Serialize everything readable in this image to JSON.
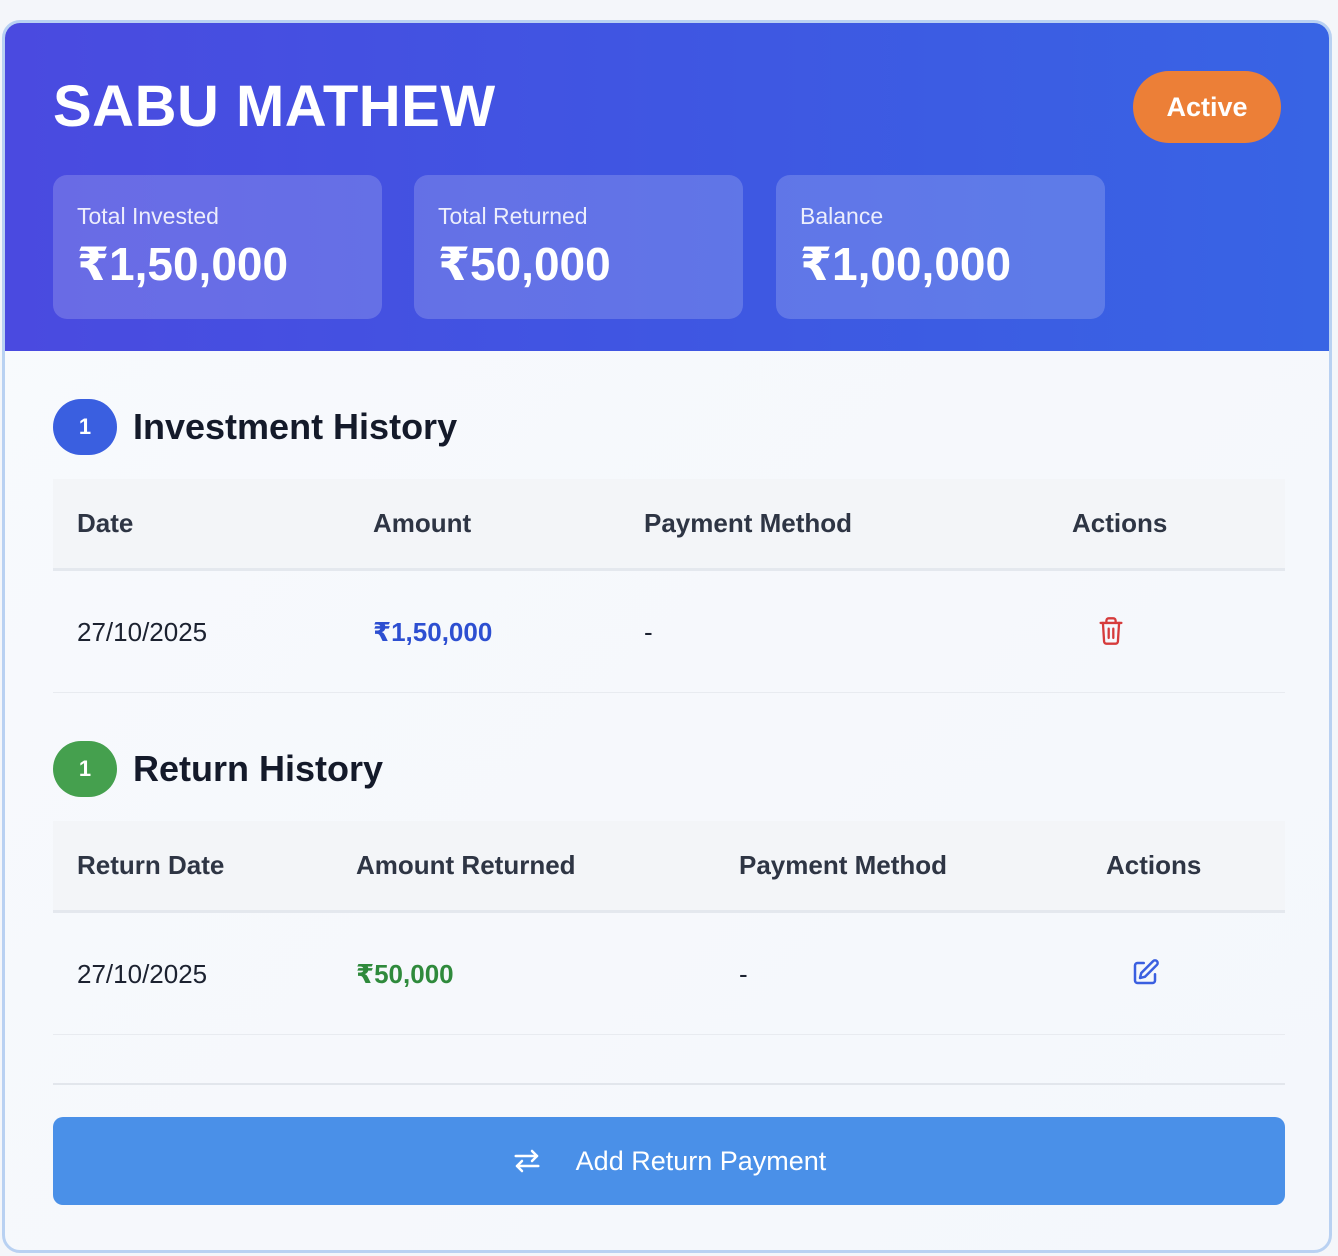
{
  "header": {
    "name": "SABU MATHEW",
    "status": "Active",
    "stats": [
      {
        "label": "Total Invested",
        "value": "₹1,50,000"
      },
      {
        "label": "Total Returned",
        "value": "₹50,000"
      },
      {
        "label": "Balance",
        "value": "₹1,00,000"
      }
    ]
  },
  "investment_history": {
    "count": "1",
    "title": "Investment History",
    "columns": [
      "Date",
      "Amount",
      "Payment Method",
      "Actions"
    ],
    "rows": [
      {
        "date": "27/10/2025",
        "amount": "₹1,50,000",
        "payment_method": "-",
        "action_icon": "trash-icon"
      }
    ]
  },
  "return_history": {
    "count": "1",
    "title": "Return History",
    "columns": [
      "Return Date",
      "Amount Returned",
      "Payment Method",
      "Actions"
    ],
    "rows": [
      {
        "date": "27/10/2025",
        "amount": "₹50,000",
        "payment_method": "-",
        "action_icon": "edit-icon"
      }
    ]
  },
  "add_button": {
    "label": "Add Return Payment",
    "icon": "swap-arrows-icon"
  },
  "colors": {
    "header_start": "#4a4ae0",
    "header_end": "#3864e4",
    "status_badge": "#ec7f37",
    "investment_badge": "#3a5fe0",
    "return_badge": "#45a04e",
    "amount_blue": "#2d4fd1",
    "amount_green": "#2f8a3c",
    "delete_red": "#d63b3b",
    "edit_blue": "#3a5fe0",
    "button": "#4a90e8"
  }
}
